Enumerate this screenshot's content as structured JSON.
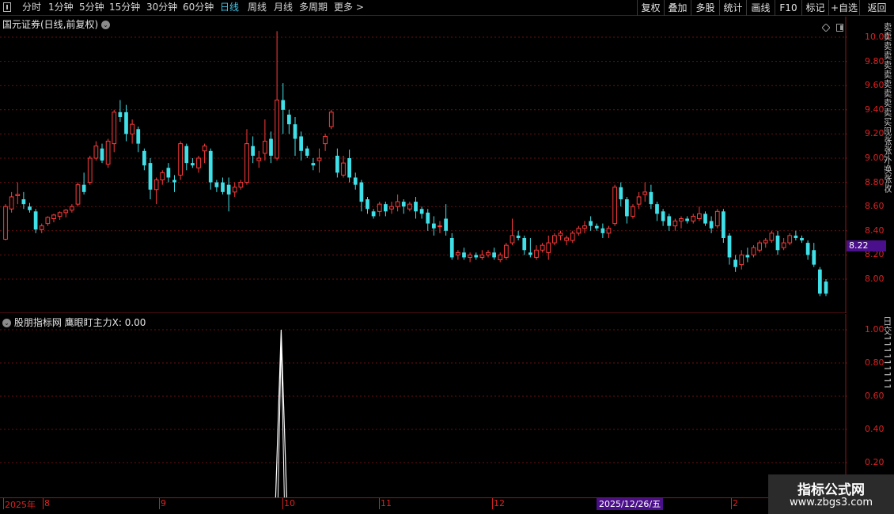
{
  "toolbar": {
    "periods": [
      {
        "label": "分时",
        "active": false
      },
      {
        "label": "1分钟",
        "active": false
      },
      {
        "label": "5分钟",
        "active": false
      },
      {
        "label": "15分钟",
        "active": false
      },
      {
        "label": "30分钟",
        "active": false
      },
      {
        "label": "60分钟",
        "active": false
      },
      {
        "label": "日线",
        "active": true
      },
      {
        "label": "周线",
        "active": false
      },
      {
        "label": "月线",
        "active": false
      },
      {
        "label": "多周期",
        "active": false
      },
      {
        "label": "更多 >",
        "active": false
      }
    ],
    "right_buttons": [
      "复权",
      "叠加",
      "多股",
      "统计",
      "画线",
      "F10",
      "标记",
      "+自选",
      "返回"
    ]
  },
  "main_panel": {
    "title": "国元证券(日线,前复权)",
    "current_price": "8.22",
    "right_strip_text": "卖卖卖卖卖卖卖卖卖卖买现涨涨外换涨收"
  },
  "indicator_panel": {
    "title": "股朋指标网 鹰眼盯主力X: 0.00",
    "right_strip_text": "日交111111111"
  },
  "time_axis": {
    "labels": [
      "2025年",
      "8",
      "9",
      "10",
      "11",
      "12",
      "2"
    ],
    "cursor_date": "2025/12/26/五"
  },
  "watermark": {
    "title": "指标公式网",
    "url": "www.zbgs3.com"
  },
  "colors": {
    "up": "#ff3b3b",
    "down": "#3fe0e8",
    "grid": "#6a1010",
    "axis_text": "#dd2222",
    "active_period": "#43c6e8",
    "highlight": "#4a0f8a"
  },
  "chart_data": [
    {
      "type": "candlestick",
      "title": "国元证券(日线,前复权)",
      "y_ticks": [
        "10.00",
        "9.80",
        "9.60",
        "9.40",
        "9.20",
        "9.00",
        "8.80",
        "8.60",
        "8.40",
        "8.20",
        "8.00"
      ],
      "ylim": [
        7.85,
        10.2
      ],
      "grid": true,
      "ohlc": [
        [
          8.33,
          8.62,
          8.32,
          8.6
        ],
        [
          8.58,
          8.72,
          8.55,
          8.68
        ],
        [
          8.69,
          8.8,
          8.62,
          8.7
        ],
        [
          8.66,
          8.72,
          8.58,
          8.62
        ],
        [
          8.6,
          8.63,
          8.55,
          8.57
        ],
        [
          8.56,
          8.58,
          8.38,
          8.41
        ],
        [
          8.41,
          8.46,
          8.38,
          8.44
        ],
        [
          8.46,
          8.52,
          8.44,
          8.51
        ],
        [
          8.5,
          8.54,
          8.47,
          8.53
        ],
        [
          8.52,
          8.56,
          8.49,
          8.55
        ],
        [
          8.55,
          8.58,
          8.51,
          8.57
        ],
        [
          8.57,
          8.62,
          8.55,
          8.6
        ],
        [
          8.62,
          8.8,
          8.6,
          8.78
        ],
        [
          8.78,
          8.88,
          8.7,
          8.72
        ],
        [
          8.8,
          9.02,
          8.78,
          9.0
        ],
        [
          9.0,
          9.14,
          8.98,
          9.1
        ],
        [
          9.08,
          9.12,
          8.96,
          8.98
        ],
        [
          8.95,
          9.16,
          8.92,
          9.14
        ],
        [
          9.12,
          9.4,
          9.05,
          9.38
        ],
        [
          9.38,
          9.48,
          9.3,
          9.34
        ],
        [
          9.38,
          9.44,
          9.14,
          9.2
        ],
        [
          9.2,
          9.32,
          9.12,
          9.28
        ],
        [
          9.24,
          9.26,
          9.05,
          9.12
        ],
        [
          9.06,
          9.08,
          8.9,
          8.94
        ],
        [
          8.96,
          9.0,
          8.66,
          8.74
        ],
        [
          8.74,
          8.84,
          8.62,
          8.82
        ],
        [
          8.82,
          8.9,
          8.78,
          8.88
        ],
        [
          8.92,
          8.96,
          8.8,
          8.84
        ],
        [
          8.82,
          8.86,
          8.72,
          8.8
        ],
        [
          8.86,
          9.14,
          8.82,
          9.12
        ],
        [
          9.1,
          9.12,
          8.9,
          8.96
        ],
        [
          8.96,
          9.0,
          8.92,
          8.94
        ],
        [
          8.92,
          9.02,
          8.88,
          9.0
        ],
        [
          9.06,
          9.12,
          8.96,
          9.1
        ],
        [
          9.06,
          9.08,
          8.74,
          8.8
        ],
        [
          8.8,
          8.82,
          8.72,
          8.76
        ],
        [
          8.8,
          8.84,
          8.7,
          8.72
        ],
        [
          8.78,
          8.84,
          8.56,
          8.7
        ],
        [
          8.72,
          8.8,
          8.68,
          8.76
        ],
        [
          8.76,
          8.82,
          8.74,
          8.8
        ],
        [
          8.8,
          9.24,
          8.78,
          9.12
        ],
        [
          9.1,
          9.18,
          8.96,
          9.02
        ],
        [
          8.98,
          9.06,
          8.92,
          9.0
        ],
        [
          9.04,
          9.32,
          8.98,
          9.14
        ],
        [
          9.16,
          9.22,
          8.96,
          9.02
        ],
        [
          9.0,
          10.05,
          8.98,
          9.48
        ],
        [
          9.48,
          9.62,
          9.2,
          9.4
        ],
        [
          9.36,
          9.4,
          9.2,
          9.28
        ],
        [
          9.28,
          9.34,
          9.02,
          9.16
        ],
        [
          9.18,
          9.22,
          8.98,
          9.06
        ],
        [
          9.08,
          9.1,
          9.0,
          9.02
        ],
        [
          8.96,
          9.0,
          8.9,
          8.94
        ],
        [
          8.98,
          9.08,
          8.88,
          9.0
        ],
        [
          9.12,
          9.2,
          9.06,
          9.18
        ],
        [
          9.26,
          9.4,
          9.24,
          9.38
        ],
        [
          9.02,
          9.08,
          8.84,
          8.88
        ],
        [
          8.86,
          9.02,
          8.84,
          8.96
        ],
        [
          9.0,
          9.07,
          8.8,
          8.84
        ],
        [
          8.84,
          8.88,
          8.74,
          8.78
        ],
        [
          8.8,
          8.82,
          8.56,
          8.64
        ],
        [
          8.66,
          8.68,
          8.54,
          8.58
        ],
        [
          8.56,
          8.58,
          8.5,
          8.52
        ],
        [
          8.56,
          8.64,
          8.52,
          8.62
        ],
        [
          8.62,
          8.64,
          8.52,
          8.56
        ],
        [
          8.58,
          8.64,
          8.54,
          8.6
        ],
        [
          8.6,
          8.7,
          8.56,
          8.64
        ],
        [
          8.64,
          8.66,
          8.54,
          8.6
        ],
        [
          8.58,
          8.64,
          8.56,
          8.62
        ],
        [
          8.64,
          8.68,
          8.5,
          8.56
        ],
        [
          8.58,
          8.6,
          8.5,
          8.54
        ],
        [
          8.55,
          8.58,
          8.4,
          8.46
        ],
        [
          8.46,
          8.52,
          8.36,
          8.42
        ],
        [
          8.44,
          8.48,
          8.38,
          8.44
        ],
        [
          8.5,
          8.62,
          8.36,
          8.4
        ],
        [
          8.34,
          8.38,
          8.16,
          8.18
        ],
        [
          8.2,
          8.24,
          8.16,
          8.22
        ],
        [
          8.22,
          8.26,
          8.16,
          8.18
        ],
        [
          8.18,
          8.22,
          8.14,
          8.2
        ],
        [
          8.2,
          8.22,
          8.16,
          8.18
        ],
        [
          8.18,
          8.24,
          8.16,
          8.2
        ],
        [
          8.2,
          8.24,
          8.18,
          8.22
        ],
        [
          8.22,
          8.26,
          8.16,
          8.18
        ],
        [
          8.16,
          8.22,
          8.14,
          8.2
        ],
        [
          8.18,
          8.3,
          8.16,
          8.28
        ],
        [
          8.3,
          8.5,
          8.28,
          8.36
        ],
        [
          8.36,
          8.4,
          8.32,
          8.34
        ],
        [
          8.34,
          8.36,
          8.2,
          8.24
        ],
        [
          8.22,
          8.34,
          8.18,
          8.2
        ],
        [
          8.18,
          8.28,
          8.16,
          8.24
        ],
        [
          8.24,
          8.3,
          8.22,
          8.28
        ],
        [
          8.22,
          8.36,
          8.16,
          8.3
        ],
        [
          8.3,
          8.38,
          8.28,
          8.36
        ],
        [
          8.36,
          8.4,
          8.32,
          8.38
        ],
        [
          8.32,
          8.36,
          8.28,
          8.34
        ],
        [
          8.32,
          8.4,
          8.3,
          8.38
        ],
        [
          8.38,
          8.44,
          8.36,
          8.42
        ],
        [
          8.42,
          8.48,
          8.38,
          8.44
        ],
        [
          8.48,
          8.52,
          8.4,
          8.44
        ],
        [
          8.44,
          8.46,
          8.4,
          8.42
        ],
        [
          8.42,
          8.46,
          8.34,
          8.38
        ],
        [
          8.38,
          8.44,
          8.34,
          8.42
        ],
        [
          8.46,
          8.78,
          8.44,
          8.76
        ],
        [
          8.76,
          8.8,
          8.6,
          8.66
        ],
        [
          8.66,
          8.68,
          8.46,
          8.52
        ],
        [
          8.52,
          8.62,
          8.5,
          8.6
        ],
        [
          8.62,
          8.72,
          8.58,
          8.68
        ],
        [
          8.7,
          8.8,
          8.64,
          8.72
        ],
        [
          8.72,
          8.78,
          8.58,
          8.62
        ],
        [
          8.62,
          8.64,
          8.48,
          8.54
        ],
        [
          8.56,
          8.58,
          8.44,
          8.48
        ],
        [
          8.52,
          8.54,
          8.4,
          8.44
        ],
        [
          8.44,
          8.5,
          8.4,
          8.48
        ],
        [
          8.48,
          8.52,
          8.42,
          8.5
        ],
        [
          8.5,
          8.52,
          8.46,
          8.48
        ],
        [
          8.48,
          8.54,
          8.46,
          8.52
        ],
        [
          8.5,
          8.6,
          8.48,
          8.54
        ],
        [
          8.54,
          8.56,
          8.44,
          8.46
        ],
        [
          8.48,
          8.52,
          8.38,
          8.42
        ],
        [
          8.44,
          8.58,
          8.42,
          8.56
        ],
        [
          8.56,
          8.58,
          8.3,
          8.34
        ],
        [
          8.36,
          8.38,
          8.12,
          8.18
        ],
        [
          8.16,
          8.2,
          8.06,
          8.1
        ],
        [
          8.12,
          8.24,
          8.08,
          8.2
        ],
        [
          8.2,
          8.26,
          8.14,
          8.18
        ],
        [
          8.2,
          8.28,
          8.18,
          8.26
        ],
        [
          8.24,
          8.32,
          8.22,
          8.3
        ],
        [
          8.3,
          8.34,
          8.26,
          8.32
        ],
        [
          8.32,
          8.4,
          8.3,
          8.38
        ],
        [
          8.36,
          8.4,
          8.2,
          8.24
        ],
        [
          8.26,
          8.34,
          8.24,
          8.3
        ],
        [
          8.3,
          8.38,
          8.28,
          8.36
        ],
        [
          8.36,
          8.4,
          8.32,
          8.34
        ],
        [
          8.34,
          8.36,
          8.3,
          8.32
        ],
        [
          8.3,
          8.32,
          8.16,
          8.2
        ],
        [
          8.24,
          8.3,
          8.1,
          8.12
        ],
        [
          8.08,
          8.1,
          7.86,
          7.88
        ],
        [
          7.98,
          8.0,
          7.86,
          7.88
        ]
      ]
    },
    {
      "type": "line",
      "title": "股朋指标网 鹰眼盯主力X: 0.00",
      "y_ticks": [
        "1.00",
        "0.80",
        "0.60",
        "0.40",
        "0.20"
      ],
      "ylim": [
        -0.05,
        1.05
      ],
      "grid": true,
      "series": [
        {
          "name": "鹰眼盯主力X",
          "spike_index": 47,
          "spike_value": 1.0,
          "baseline": 0.0
        }
      ]
    }
  ]
}
